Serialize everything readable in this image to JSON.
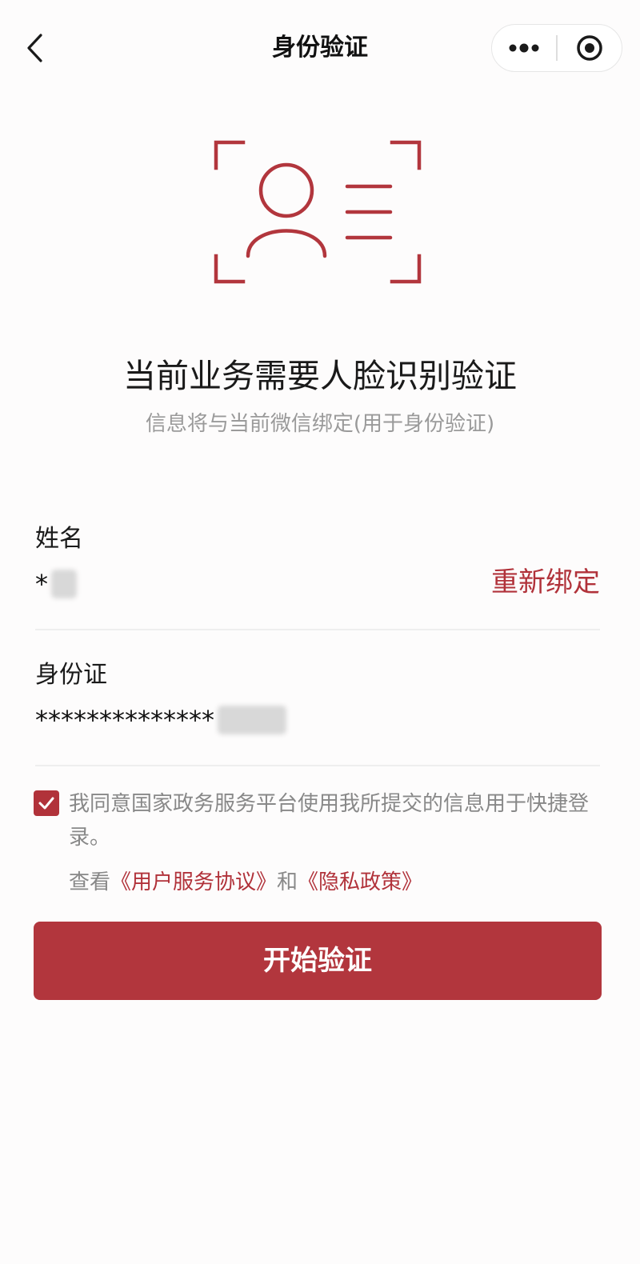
{
  "nav": {
    "title": "身份验证",
    "back_icon": "chevron-left-icon",
    "more_icon": "more-dots-icon",
    "close_icon": "target-icon"
  },
  "hero": {
    "icon": "face-id-scan-icon",
    "title": "当前业务需要人脸识别验证",
    "subtitle": "信息将与当前微信绑定(用于身份验证)"
  },
  "form": {
    "name_label": "姓名",
    "name_value": "*",
    "rebind_label": "重新绑定",
    "id_label": "身份证",
    "id_value": "**************"
  },
  "agreement": {
    "checked": true,
    "text": "我同意国家政务服务平台使用我所提交的信息用于快捷登录。",
    "view_prefix": "查看",
    "service_link": "《用户服务协议》",
    "and_text": "和",
    "privacy_link": "《隐私政策》"
  },
  "actions": {
    "start_label": "开始验证"
  },
  "colors": {
    "accent": "#b2363d",
    "muted_text": "#9a9a9a",
    "background": "#fdfcfc"
  }
}
